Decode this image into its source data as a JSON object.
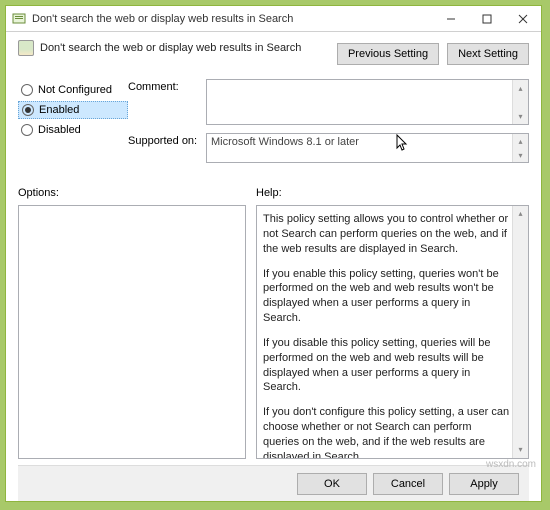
{
  "window": {
    "title": "Don't search the web or display web results in Search"
  },
  "header": {
    "policy_name": "Don't search the web or display web results in Search",
    "prev_btn": "Previous Setting",
    "next_btn": "Next Setting"
  },
  "state": {
    "options": {
      "not_configured": "Not Configured",
      "enabled": "Enabled",
      "disabled": "Disabled"
    },
    "selected": "enabled"
  },
  "fields": {
    "comment_label": "Comment:",
    "comment_value": "",
    "supported_label": "Supported on:",
    "supported_value": "Microsoft Windows 8.1 or later"
  },
  "panes": {
    "options_label": "Options:",
    "help_label": "Help:",
    "help_paragraphs": [
      "This policy setting allows you to control whether or not Search can perform queries on the web, and if the web results are displayed in Search.",
      "If you enable this policy setting, queries won't be performed on the web and web results won't be displayed when a user performs a query in Search.",
      "If you disable this policy setting, queries will be performed on the web and web results will be displayed when a user performs a query in Search.",
      "If you don't configure this policy setting, a user can choose whether or not Search can perform queries on the web, and if the web results are displayed in Search."
    ]
  },
  "footer": {
    "ok": "OK",
    "cancel": "Cancel",
    "apply": "Apply"
  },
  "watermark": "wsxdn.com"
}
